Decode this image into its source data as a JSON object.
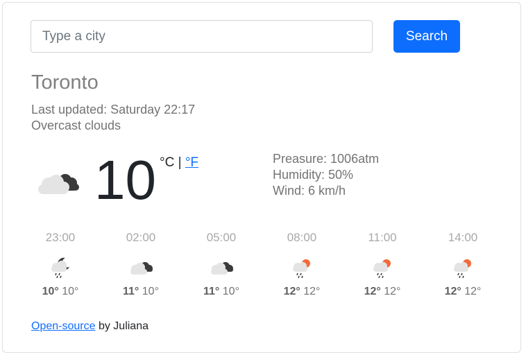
{
  "search": {
    "placeholder": "Type a city",
    "button_label": "Search"
  },
  "current": {
    "city": "Toronto",
    "last_updated": "Last updated: Saturday 22:17",
    "description": "Overcast clouds",
    "icon": "overcast-clouds-icon",
    "temperature": "10",
    "unit_celsius": "°C",
    "unit_separator": " | ",
    "unit_fahrenheit": "°F",
    "pressure": "Preasure: 1006atm",
    "humidity": "Humidity: 50%",
    "wind": "Wind: 6 km/h"
  },
  "forecast": [
    {
      "time": "23:00",
      "icon": "night-rain-icon",
      "max": "10°",
      "min": "10°"
    },
    {
      "time": "02:00",
      "icon": "overcast-clouds-icon",
      "max": "11°",
      "min": "10°"
    },
    {
      "time": "05:00",
      "icon": "overcast-clouds-icon",
      "max": "11°",
      "min": "10°"
    },
    {
      "time": "08:00",
      "icon": "day-rain-icon",
      "max": "12°",
      "min": "12°"
    },
    {
      "time": "11:00",
      "icon": "day-rain-icon",
      "max": "12°",
      "min": "12°"
    },
    {
      "time": "14:00",
      "icon": "day-rain-icon",
      "max": "12°",
      "min": "12°"
    }
  ],
  "footer": {
    "link_text": "Open-source",
    "suffix": " by Juliana"
  },
  "colors": {
    "accent": "#0d6efd",
    "sun": "#f26b3a",
    "cloud_light": "#e4e4e4",
    "cloud_dark": "#3a3a3a"
  }
}
